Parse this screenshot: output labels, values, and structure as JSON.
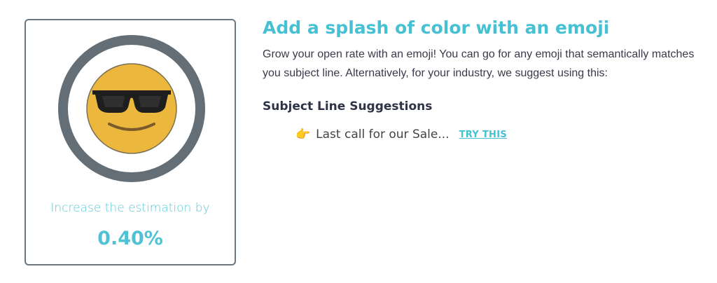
{
  "card": {
    "emoji_icon": "smiling-face-with-sunglasses-icon",
    "ring_color": "#636e76",
    "face_color": "#ebb73c",
    "estimate_label": "Increase the estimation by",
    "estimate_value": "0.40%"
  },
  "content": {
    "title": "Add a splash of color with an emoji",
    "description": "Grow your open rate with an emoji! You can go for any emoji that semantically matches you subject line. Alternatively, for your industry, we suggest using this:",
    "subheading": "Subject Line Suggestions",
    "suggestion": {
      "emoji": "👉",
      "icon": "backhand-index-pointing-right-icon",
      "text": "Last call for our Sale...",
      "action_label": "TRY THIS"
    }
  },
  "colors": {
    "accent": "#45c1d3",
    "border": "#6b7780",
    "text_dark": "#2f3347"
  }
}
